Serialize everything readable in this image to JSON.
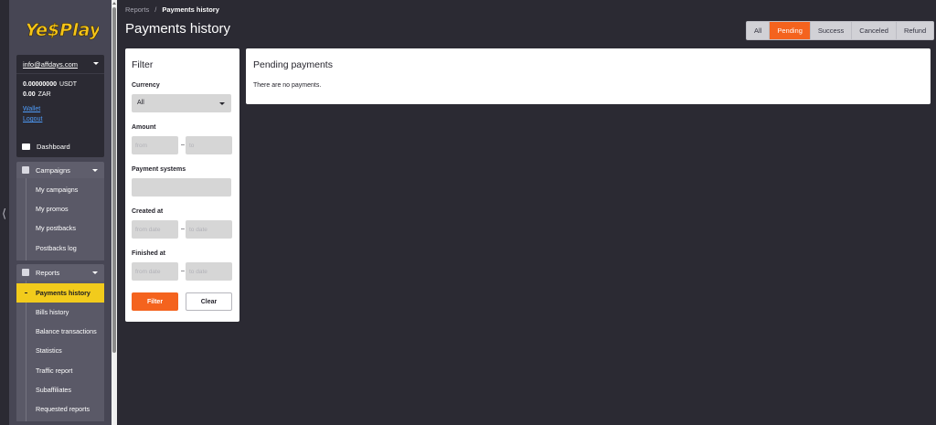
{
  "sidebar": {
    "brand": "Ye$Play",
    "account": {
      "email": "info@affdays.com",
      "balances": [
        {
          "amount": "0.00000000",
          "currency": "USDT"
        },
        {
          "amount": "0.00",
          "currency": "ZAR"
        }
      ],
      "wallet_label": "Wallet",
      "logout_label": "Logout"
    },
    "dashboard_label": "Dashboard",
    "campaigns": {
      "label": "Campaigns",
      "items": [
        "My campaigns",
        "My promos",
        "My postbacks",
        "Postbacks log"
      ]
    },
    "reports": {
      "label": "Reports",
      "items": [
        "Payments history",
        "Bills history",
        "Balance transactions",
        "Statistics",
        "Traffic report",
        "Subaffiliates",
        "Requested reports"
      ],
      "active_index": 0
    }
  },
  "breadcrumb": {
    "parent": "Reports",
    "separator": "/",
    "current": "Payments history"
  },
  "page_title": "Payments history",
  "status_tabs": {
    "items": [
      "All",
      "Pending",
      "Success",
      "Canceled",
      "Refund"
    ],
    "active": "Pending"
  },
  "filter": {
    "title": "Filter",
    "currency_label": "Currency",
    "currency_value": "All",
    "amount_label": "Amount",
    "amount_from_placeholder": "from",
    "amount_to_placeholder": "to",
    "range_dash": "–",
    "payment_systems_label": "Payment systems",
    "created_label": "Created at",
    "created_from_placeholder": "from date",
    "created_to_placeholder": "to date",
    "finished_label": "Finished at",
    "finished_from_placeholder": "from date",
    "finished_to_placeholder": "to date",
    "filter_button": "Filter",
    "clear_button": "Clear"
  },
  "pending_panel": {
    "title": "Pending payments",
    "empty_message": "There are no payments."
  },
  "colors": {
    "accent_orange": "#f4631e",
    "active_nav_yellow": "#f2cb1c",
    "sidebar_bg": "#474654",
    "page_bg": "#2b2a33",
    "link_blue": "#4f9cf9"
  }
}
